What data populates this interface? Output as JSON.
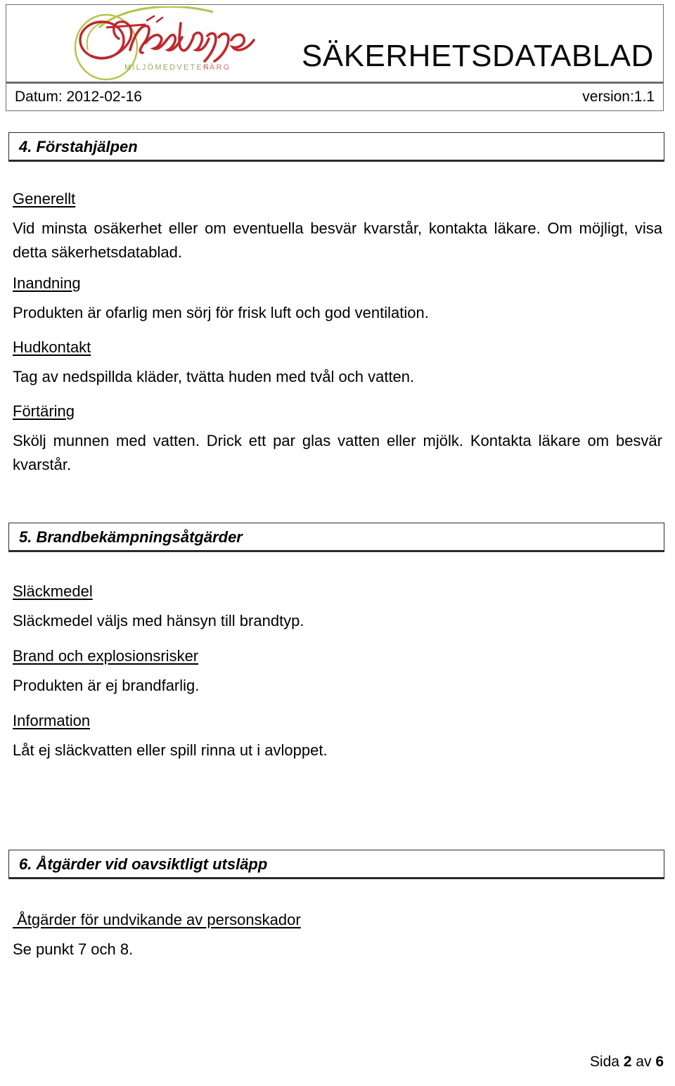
{
  "document": {
    "title": "SÄKERHETSDATABLAD",
    "date_label": "Datum: 2012-02-16",
    "version_label": "version:1.1"
  },
  "logo": {
    "wordmark": "Färgbrygge",
    "tagline_part1": "MILJÖMEDVETEN",
    "tagline_part2": "FÄRG",
    "colors": {
      "script_red": "#c0272d",
      "swoosh_olive": "#b5c24a",
      "tagline_olive": "#a8a06a",
      "tagline_red": "#d4707a"
    }
  },
  "sections": [
    {
      "heading": "4. Förstahjälpen",
      "blocks": [
        {
          "subhead": "Generellt",
          "text": "Vid minsta osäkerhet eller om eventuella besvär kvarstår, kontakta läkare. Om möjligt, visa detta säkerhetsdatablad."
        },
        {
          "subhead": "Inandning",
          "text": "Produkten är ofarlig men sörj för frisk luft och god ventilation."
        },
        {
          "subhead": "Hudkontakt",
          "text": "Tag av nedspillda kläder, tvätta huden med tvål och vatten."
        },
        {
          "subhead": "Förtäring",
          "text": "Skölj munnen med vatten. Drick ett par glas vatten eller mjölk. Kontakta läkare om besvär kvarstår."
        }
      ]
    },
    {
      "heading": "5. Brandbekämpningsåtgärder",
      "blocks": [
        {
          "subhead": "Släckmedel",
          "text": "Släckmedel väljs med hänsyn till brandtyp."
        },
        {
          "subhead": "Brand och explosionsrisker",
          "text": "Produkten är ej brandfarlig."
        },
        {
          "subhead": "Information",
          "text": "Låt ej släckvatten eller spill rinna ut i avloppet."
        }
      ]
    },
    {
      "heading": "6. Åtgärder vid oavsiktligt utsläpp",
      "blocks": [
        {
          "subhead": " Åtgärder för undvikande av personskador",
          "text": "Se punkt 7 och 8."
        }
      ]
    }
  ],
  "footer": {
    "prefix": "Sida ",
    "current_page": "2",
    "middle": " av ",
    "total_pages": "6"
  }
}
